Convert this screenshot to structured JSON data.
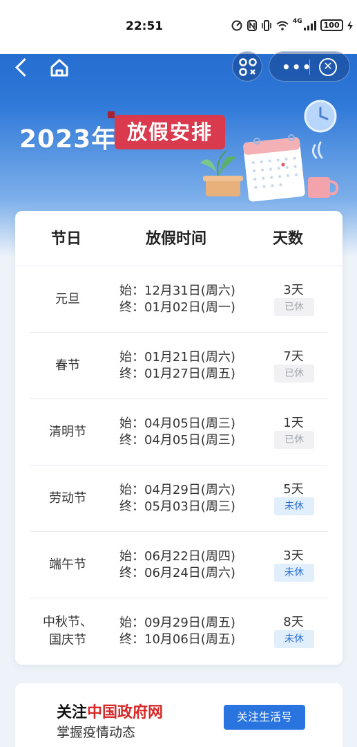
{
  "status_bar": {
    "time": "22:51",
    "network": "4G",
    "battery": "100"
  },
  "navbar": {
    "back_icon": "back-arrow-icon",
    "home_icon": "home-icon",
    "scan_icon": "scan-code-icon",
    "more_label": "•••",
    "close_icon": "close-circle-icon"
  },
  "banner": {
    "year": "2023年",
    "tag": "放假安排"
  },
  "colors": {
    "brand_blue": "#1d63c6",
    "tag_red": "#d93a4d",
    "badge_done_bg": "#f1f1f3",
    "badge_todo_bg": "#e1effd",
    "badge_todo_text": "#2b6fd0",
    "follow_btn": "#2a74e0"
  },
  "table": {
    "headers": [
      "节日",
      "放假时间",
      "天数"
    ],
    "rows": [
      {
        "name": "元旦",
        "start": "始：12月31日(周六)",
        "end": "终：01月02日(周一)",
        "days": "3天",
        "status": "已休",
        "done": true
      },
      {
        "name": "春节",
        "start": "始：01月21日(周六)",
        "end": "终：01月27日(周五)",
        "days": "7天",
        "status": "已休",
        "done": true
      },
      {
        "name": "清明节",
        "start": "始：04月05日(周三)",
        "end": "终：04月05日(周三)",
        "days": "1天",
        "status": "已休",
        "done": true
      },
      {
        "name": "劳动节",
        "start": "始：04月29日(周六)",
        "end": "终：05月03日(周三)",
        "days": "5天",
        "status": "未休",
        "done": false
      },
      {
        "name": "端午节",
        "start": "始：06月22日(周四)",
        "end": "终：06月24日(周六)",
        "days": "3天",
        "status": "未休",
        "done": false
      },
      {
        "name": "中秋节、\n国庆节",
        "start": "始：09月29日(周五)",
        "end": "终：10月06日(周五)",
        "days": "8天",
        "status": "未休",
        "done": false
      }
    ]
  },
  "follow": {
    "prefix": "关注",
    "highlight": "中国政府网",
    "subtitle": "掌握疫情动态",
    "button": "关注生活号"
  }
}
